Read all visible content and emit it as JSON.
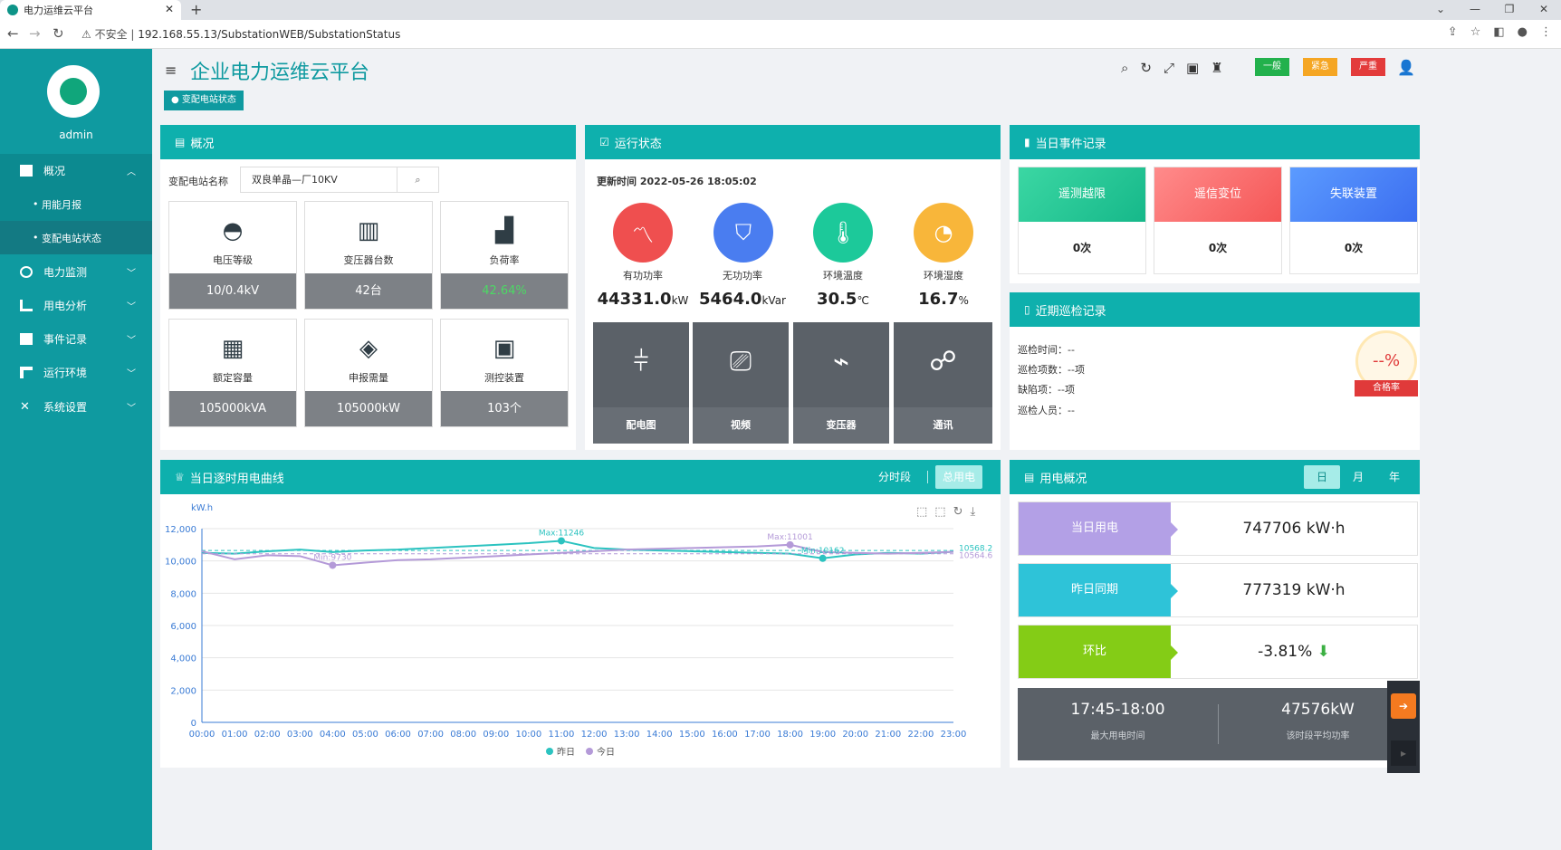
{
  "browser": {
    "tab_title": "电力运维云平台",
    "insecure_label": "不安全",
    "url": "192.168.55.13/SubstationWEB/SubstationStatus"
  },
  "sidebar": {
    "username": "admin",
    "menu": [
      {
        "label": "概况",
        "icon": "monitor-icon",
        "expanded": true
      },
      {
        "label": "用能月报",
        "sub": true
      },
      {
        "label": "变配电站状态",
        "sub": true,
        "active": true
      },
      {
        "label": "电力监测",
        "icon": "power-icon"
      },
      {
        "label": "用电分析",
        "icon": "bar-chart-icon"
      },
      {
        "label": "事件记录",
        "icon": "document-icon"
      },
      {
        "label": "运行环境",
        "icon": "pipe-icon"
      },
      {
        "label": "系统设置",
        "icon": "tools-icon"
      }
    ]
  },
  "header": {
    "title": "企业电力运维云平台",
    "alarms": {
      "normal": "一般",
      "urgent": "紧急",
      "severe": "严重"
    },
    "breadcrumb": "变配电站状态"
  },
  "overview": {
    "title": "概况",
    "station_label": "变配电站名称",
    "station_value": "双良单晶—厂10KV",
    "cells": [
      {
        "label": "电压等级",
        "value": "10/0.4kV",
        "icon": "gauge-icon"
      },
      {
        "label": "变压器台数",
        "value": "42台",
        "icon": "transformer-icon"
      },
      {
        "label": "负荷率",
        "value": "42.64%",
        "icon": "load-chart-icon",
        "highlight": "#4cd964"
      },
      {
        "label": "额定容量",
        "value": "105000kVA",
        "icon": "cabinet-icon"
      },
      {
        "label": "申报需量",
        "value": "105000kW",
        "icon": "layers-icon"
      },
      {
        "label": "测控装置",
        "value": "103个",
        "icon": "device-icon"
      }
    ]
  },
  "run_status": {
    "title": "运行状态",
    "updated": "更新时间 2022-05-26 18:05:02",
    "metrics": [
      {
        "label": "有功功率",
        "value": "44331.0",
        "unit": "kW",
        "color": "#ef4f4f"
      },
      {
        "label": "无功功率",
        "value": "5464.0",
        "unit": "kVar",
        "color": "#4a7df0"
      },
      {
        "label": "环境温度",
        "value": "30.5",
        "unit": "℃",
        "color": "#1cc99a"
      },
      {
        "label": "环境湿度",
        "value": "16.7",
        "unit": "%",
        "color": "#f8b63a"
      }
    ],
    "tiles": [
      "配电图",
      "视频",
      "变压器",
      "通讯"
    ]
  },
  "events": {
    "title": "当日事件记录",
    "items": [
      {
        "label": "遥测越限",
        "count": "0次"
      },
      {
        "label": "遥信变位",
        "count": "0次"
      },
      {
        "label": "失联装置",
        "count": "0次"
      }
    ]
  },
  "patrol": {
    "title": "近期巡检记录",
    "lines": [
      "巡检时间：--",
      "巡检项数：--项",
      "缺陷项：--项",
      "巡检人员：--"
    ],
    "rate": "--%",
    "rate_label": "合格率"
  },
  "curve": {
    "title": "当日逐时用电曲线",
    "seg_label": "分时段",
    "total_label": "总用电"
  },
  "usage": {
    "title": "用电概况",
    "tabs": [
      "日",
      "月",
      "年"
    ],
    "rows": [
      {
        "label": "当日用电",
        "value": "747706 kW·h",
        "color": "#b3a0e6"
      },
      {
        "label": "昨日同期",
        "value": "777319 kW·h",
        "color": "#2ec3d8"
      },
      {
        "label": "环比",
        "value": "-3.81%",
        "color": "#84cc16"
      }
    ],
    "peak_time": "17:45-18:00",
    "peak_time_label": "最大用电时间",
    "avg_power": "47576kW",
    "avg_power_label": "该时段平均功率"
  },
  "chart_data": {
    "type": "line",
    "ylabel": "kW.h",
    "ylim": [
      0,
      12000
    ],
    "yticks": [
      "0",
      "2,000",
      "4,000",
      "6,000",
      "8,000",
      "10,000",
      "12,000"
    ],
    "categories": [
      "00:00",
      "01:00",
      "02:00",
      "03:00",
      "04:00",
      "05:00",
      "06:00",
      "07:00",
      "08:00",
      "09:00",
      "10:00",
      "11:00",
      "12:00",
      "13:00",
      "14:00",
      "15:00",
      "16:00",
      "17:00",
      "18:00",
      "19:00",
      "20:00",
      "21:00",
      "22:00",
      "23:00"
    ],
    "series": [
      {
        "name": "昨日",
        "color": "#2cc3c0",
        "values": [
          10500,
          10450,
          10600,
          10700,
          10550,
          10650,
          10700,
          10800,
          10900,
          11000,
          11100,
          11246,
          10800,
          10700,
          10650,
          10600,
          10550,
          10500,
          10450,
          10162,
          10400,
          10500,
          10450,
          10568.2
        ]
      },
      {
        "name": "今日",
        "color": "#b49ad8",
        "values": [
          10600,
          10100,
          10350,
          10300,
          9730,
          9900,
          10050,
          10100,
          10200,
          10300,
          10400,
          10500,
          10600,
          10700,
          10750,
          10800,
          10850,
          10900,
          11001,
          10550,
          10500,
          10450,
          10500,
          10564.6
        ]
      }
    ],
    "annotations": [
      {
        "text": "Max:11246",
        "series": "昨日",
        "x": "11:00",
        "y": 11246
      },
      {
        "text": "Min:9730",
        "series": "今日",
        "x": "04:00",
        "y": 9730
      },
      {
        "text": "Max:11001",
        "series": "今日",
        "x": "18:00",
        "y": 11001
      },
      {
        "text": "Min:10162",
        "series": "昨日",
        "x": "19:00",
        "y": 10162
      },
      {
        "text": "10568.2",
        "series": "昨日",
        "x": "23:00",
        "y": 10568.2
      },
      {
        "text": "10564.6",
        "series": "今日",
        "x": "23:00",
        "y": 10564.6
      }
    ]
  }
}
